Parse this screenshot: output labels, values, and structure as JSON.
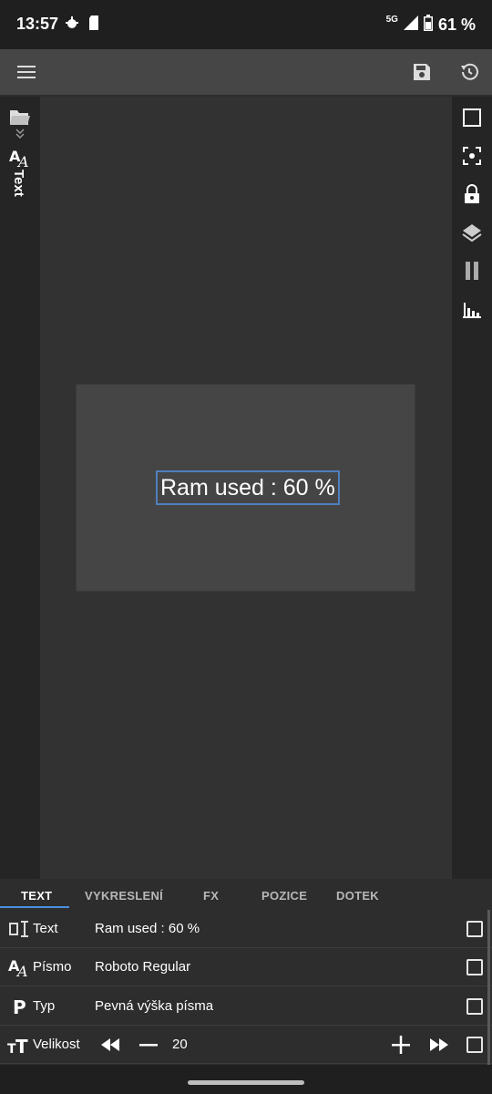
{
  "status_bar": {
    "time": "13:57",
    "network": "5G",
    "battery": "61 %",
    "icons": [
      "bug-icon",
      "sd-card-icon",
      "signal-icon",
      "battery-icon"
    ]
  },
  "toolbar": {
    "icons": [
      "menu-icon",
      "save-icon",
      "history-icon"
    ]
  },
  "left_rail": {
    "vertical_label": "Text",
    "icons": [
      "folder-icon",
      "double-chevron-down-icon",
      "font-icon"
    ]
  },
  "right_rail": {
    "icons": [
      "square-icon",
      "focus-icon",
      "lock-icon",
      "layers-icon",
      "pause-icon",
      "chart-icon"
    ]
  },
  "canvas": {
    "widget_text": "Ram used : 60 %"
  },
  "tabs": [
    {
      "label": "TEXT",
      "active": true
    },
    {
      "label": "VYKRESLENÍ",
      "active": false
    },
    {
      "label": "FX",
      "active": false
    },
    {
      "label": "POZICE",
      "active": false
    },
    {
      "label": "DOTEK",
      "active": false
    }
  ],
  "properties": {
    "text": {
      "label": "Text",
      "value": "Ram used : 60 %",
      "icon": "text-field-icon"
    },
    "font": {
      "label": "Písmo",
      "value": "Roboto Regular",
      "icon": "font-icon"
    },
    "type": {
      "label": "Typ",
      "value": "Pevná výška písma",
      "icon": "p-letter-icon"
    },
    "size": {
      "label": "Velikost",
      "value": "20",
      "icon": "text-size-icon"
    }
  },
  "colors": {
    "accent": "#4a90e2",
    "selection": "#4f7fbf",
    "background": "#2d2d2d"
  }
}
